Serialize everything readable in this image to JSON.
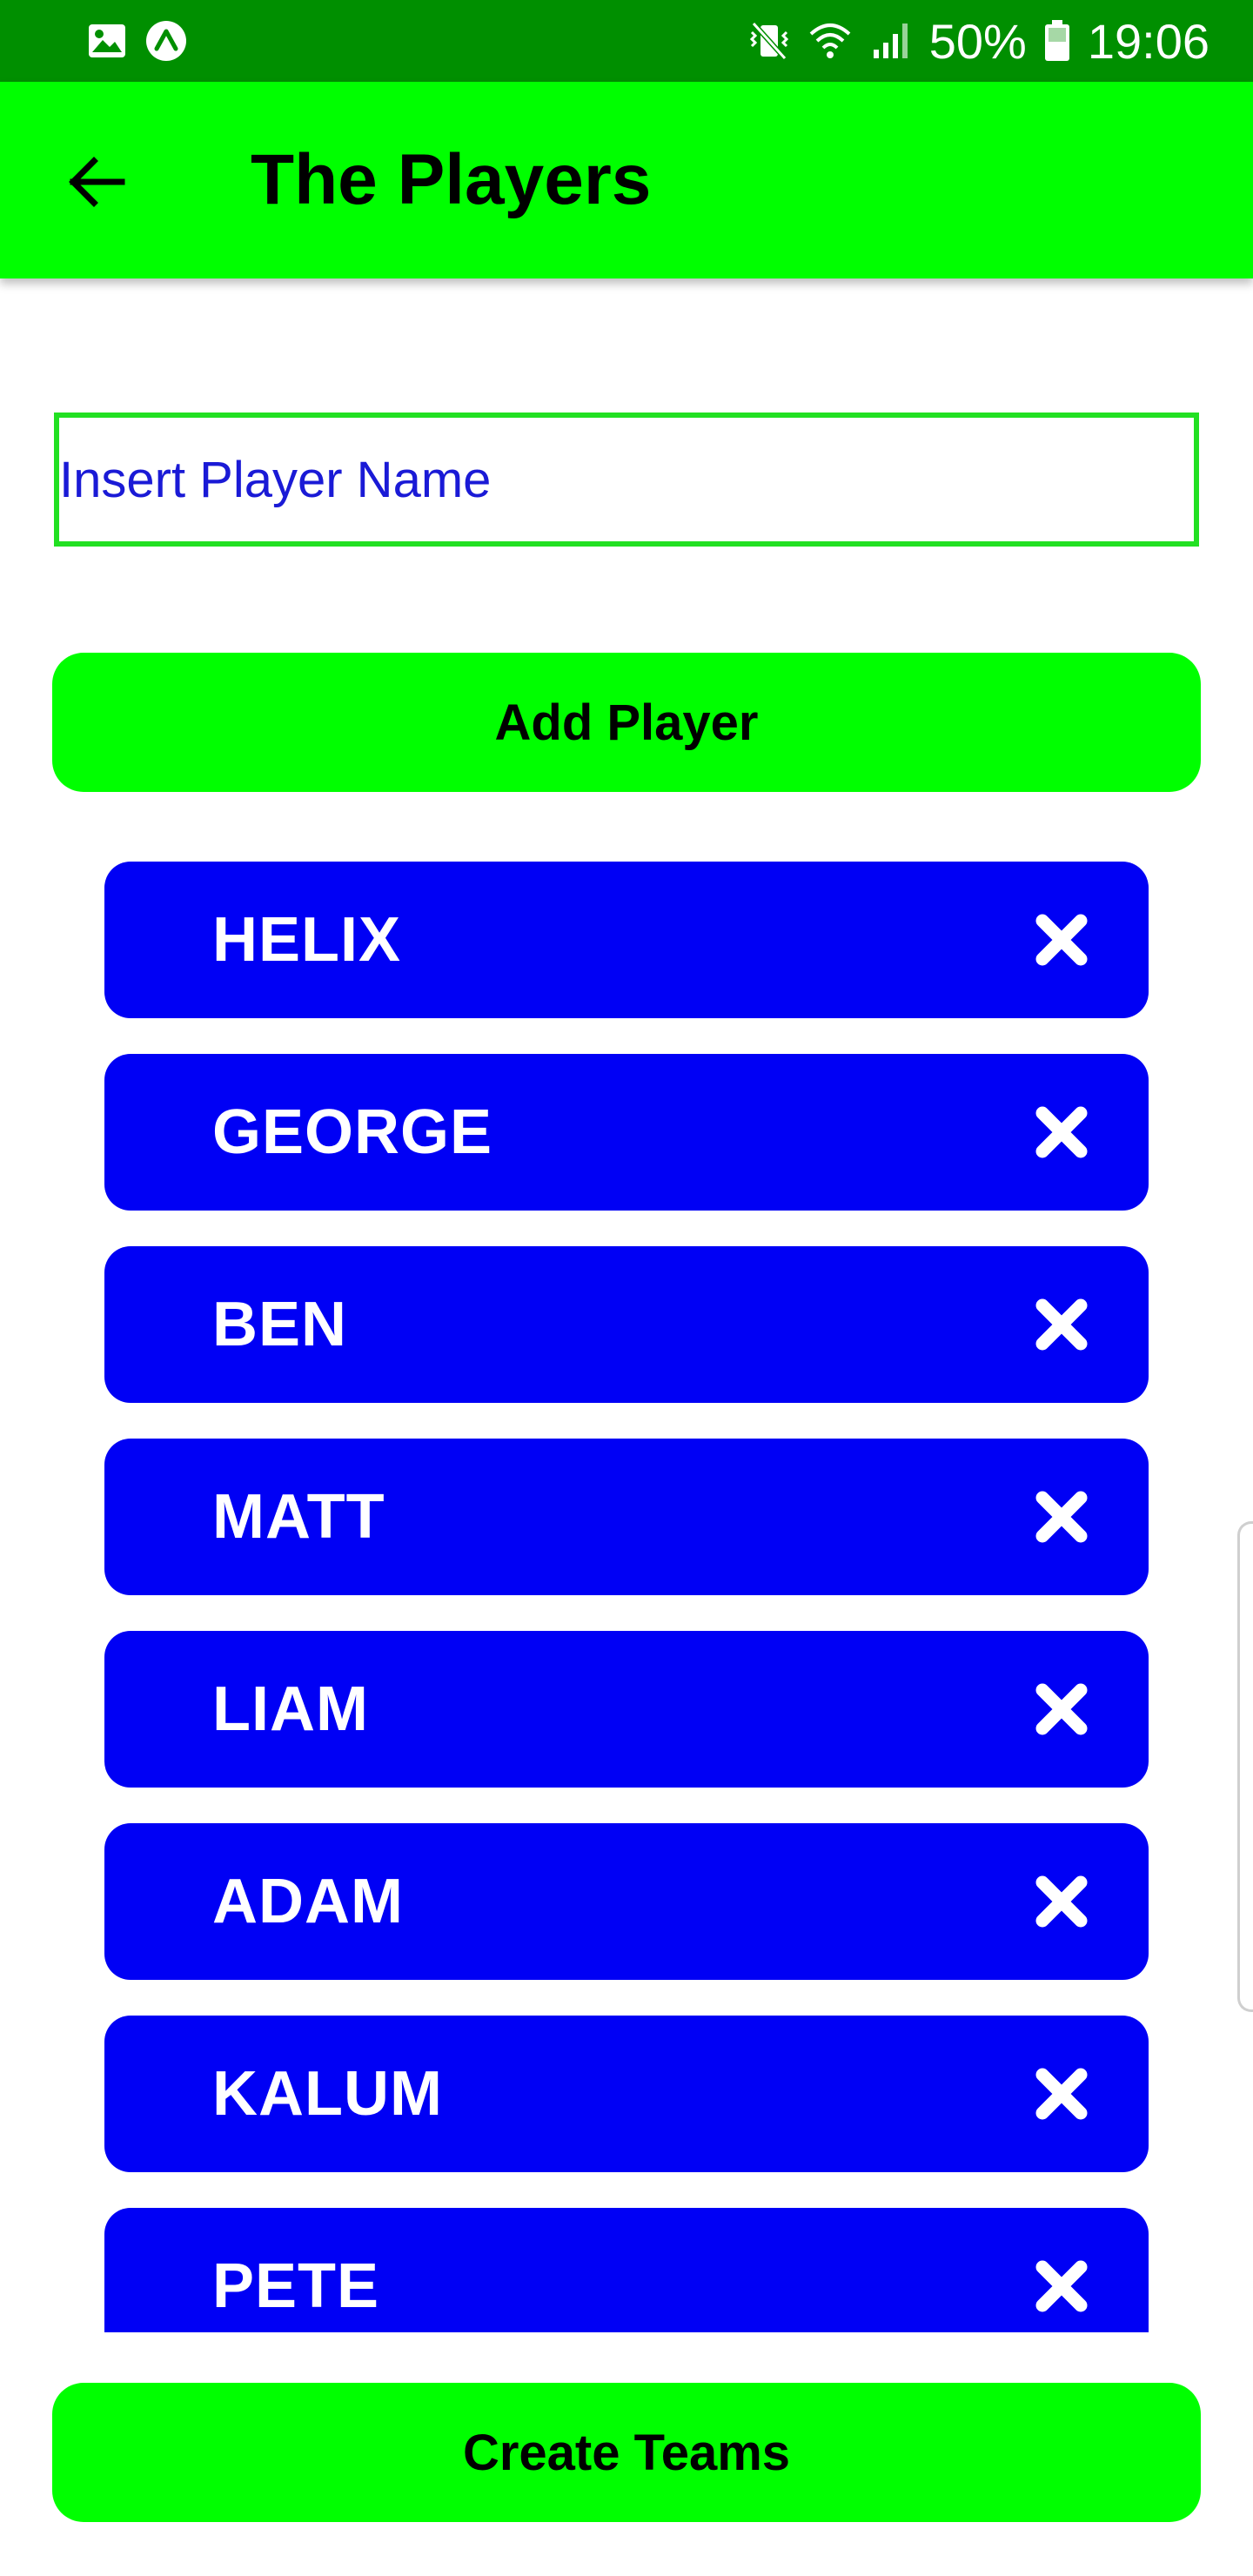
{
  "status_bar": {
    "battery_text": "50%",
    "time": "19:06",
    "left_icons": [
      "image-icon",
      "expo-icon"
    ],
    "right_icons": [
      "mute-vibrate-icon",
      "wifi-icon",
      "signal-icon",
      "battery-icon"
    ],
    "background_color": "#008f00"
  },
  "app_bar": {
    "title": "The Players",
    "back_icon": "arrow-left-icon",
    "background_color": "#00ff00"
  },
  "player_input": {
    "placeholder": "Insert Player Name",
    "value": ""
  },
  "add_button": {
    "label": "Add Player"
  },
  "players": [
    {
      "name": "HELIX"
    },
    {
      "name": "GEORGE"
    },
    {
      "name": "BEN"
    },
    {
      "name": "MATT"
    },
    {
      "name": "LIAM"
    },
    {
      "name": "ADAM"
    },
    {
      "name": "KALUM"
    },
    {
      "name": "PETE"
    }
  ],
  "player_item_color": "#0000f5",
  "delete_icon": "close-x-icon",
  "create_button": {
    "label": "Create Teams"
  }
}
